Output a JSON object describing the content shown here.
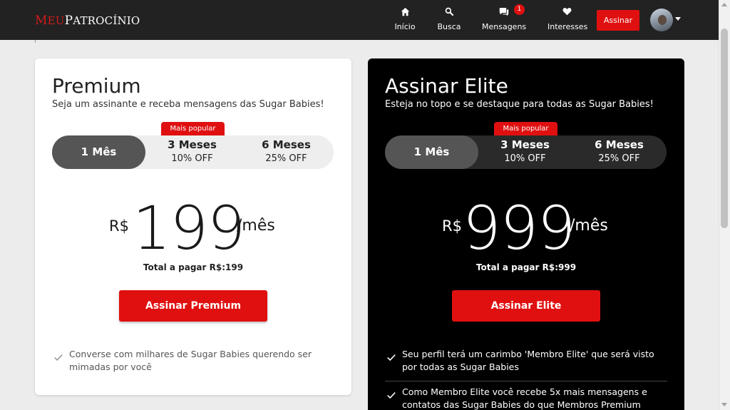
{
  "nav": {
    "logo_prefix": "M",
    "logo_rest_1": "EU",
    "logo_mid": "P",
    "logo_rest_2": "ATROCÍNIO",
    "items": [
      {
        "label": "Início",
        "icon": "home-icon"
      },
      {
        "label": "Busca",
        "icon": "search-icon"
      },
      {
        "label": "Mensagens",
        "icon": "messages-icon",
        "badge": "1"
      },
      {
        "label": "Interesses",
        "icon": "heart-icon"
      }
    ],
    "subscribe_label": "Assinar"
  },
  "colors": {
    "accent": "#e01010",
    "topbar": "#222222",
    "dark_card": "#000000"
  },
  "premium": {
    "title": "Premium",
    "subtitle": "Seja um assinante e receba mensagens das Sugar Babies!",
    "popular_label": "Mais popular",
    "options": [
      {
        "name": "1 Mês",
        "discount": ""
      },
      {
        "name": "3 Meses",
        "discount": "10% OFF"
      },
      {
        "name": "6 Meses",
        "discount": "25% OFF"
      }
    ],
    "selected_option": "1 Mês",
    "currency": "R$",
    "amount": "199",
    "period": "/mês",
    "total": "Total a pagar R$:199",
    "cta": "Assinar Premium",
    "features": [
      "Converse com milhares de Sugar Babies querendo ser mimadas por você"
    ]
  },
  "elite": {
    "title": "Assinar Elite",
    "subtitle": "Esteja no topo e se destaque para todas as Sugar Babies!",
    "popular_label": "Mais popular",
    "options": [
      {
        "name": "1 Mês",
        "discount": ""
      },
      {
        "name": "3 Meses",
        "discount": "10% OFF"
      },
      {
        "name": "6 Meses",
        "discount": "25% OFF"
      }
    ],
    "selected_option": "1 Mês",
    "currency": "R$",
    "amount": "999",
    "period": "/mês",
    "total": "Total a pagar R$:999",
    "cta": "Assinar Elite",
    "features": [
      "Seu perfil terá um carimbo 'Membro Elite' que será visto por todas as Sugar Babies",
      "Como Membro Elite você recebe 5x mais mensagens e contatos das Sugar Babies do que Membros Premium"
    ]
  }
}
